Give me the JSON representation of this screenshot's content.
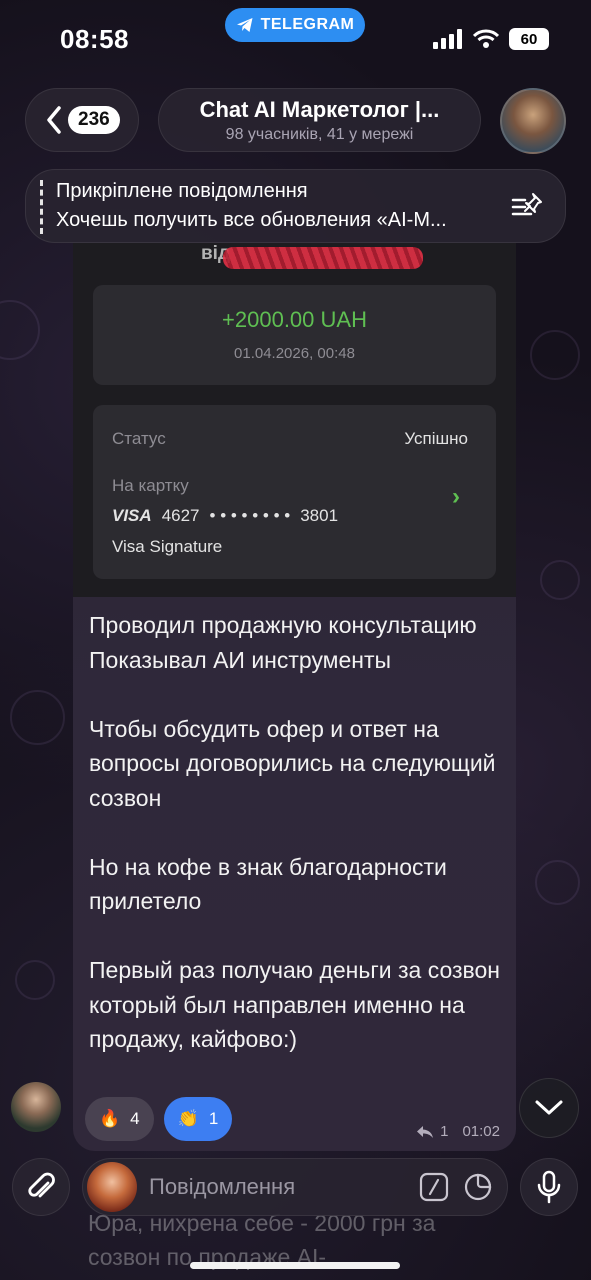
{
  "status_bar": {
    "time": "08:58",
    "app_pill": "TELEGRAM",
    "battery": "60"
  },
  "header": {
    "back_count": "236",
    "title": "Chat AI Маркетолог |...",
    "subtitle": "98 учасників, 41 у мережі"
  },
  "pinned": {
    "label": "Прикріплене повідомлення",
    "text": "Хочешь получить все обновления «AI-M..."
  },
  "receipt": {
    "from_prefix": "від",
    "amount": "+2000.00 UAH",
    "date": "01.04.2026, 00:48",
    "status_label": "Статус",
    "status_value": "Успішно",
    "card_label": "На картку",
    "card_brand": "VISA",
    "card_prefix": "4627",
    "card_mask": "• • • •  • • • •",
    "card_suffix": "3801",
    "card_type": "Visa Signature"
  },
  "message": {
    "text": "Проводил продажную консультацию\nПоказывал АИ инструменты\n\nЧтобы обсудить офер и ответ на вопросы договорились на следующий созвон\n\nНо на кофе в знак благодарности прилетело\n\nПервый раз получаю деньги за созвон который был направлен именно на продажу, кайфово:)",
    "reactions": [
      {
        "emoji": "🔥",
        "count": "4"
      },
      {
        "emoji": "👏",
        "count": "1"
      }
    ],
    "reply_count": "1",
    "time": "01:02"
  },
  "next_message_preview": "Юра, нихрена себе - 2000 грн за созвон по продаже AI-",
  "composer": {
    "placeholder": "Повідомлення"
  },
  "colors": {
    "telegram_blue": "#2d8ef2",
    "amount_green": "#5fbf52",
    "clap_reaction": "#3d7ef2"
  }
}
